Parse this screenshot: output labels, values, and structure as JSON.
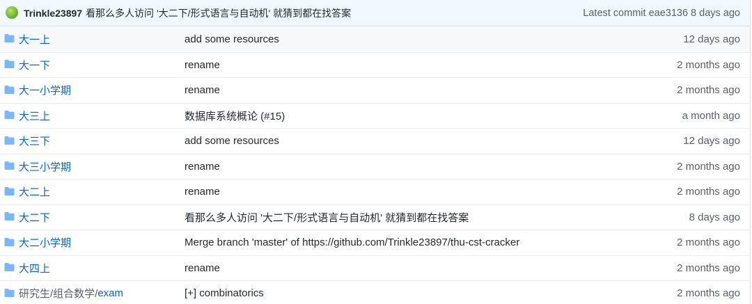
{
  "commit_bar": {
    "author": "Trinkle23897",
    "message": "看那么多人访问 '大二下/形式语言与自动机' 就猜到都在找答案",
    "latest_commit_label": "Latest commit",
    "sha": "eae3136",
    "age": "8 days ago"
  },
  "rows": [
    {
      "name": "大一上",
      "message": "add some resources",
      "age": "12 days ago"
    },
    {
      "name": "大一下",
      "message": "rename",
      "age": "2 months ago"
    },
    {
      "name": "大一小学期",
      "message": "rename",
      "age": "2 months ago"
    },
    {
      "name": "大三上",
      "message": "数据库系统概论 (#15)",
      "age": "a month ago"
    },
    {
      "name": "大三下",
      "message": "add some resources",
      "age": "12 days ago"
    },
    {
      "name": "大三小学期",
      "message": "rename",
      "age": "2 months ago"
    },
    {
      "name": "大二上",
      "message": "rename",
      "age": "2 months ago"
    },
    {
      "name": "大二下",
      "message": "看那么多人访问 '大二下/形式语言与自动机' 就猜到都在找答案",
      "age": "8 days ago"
    },
    {
      "name": "大二小学期",
      "message": "Merge branch 'master' of https://github.com/Trinkle23897/thu-cst-cracker",
      "age": "2 months ago"
    },
    {
      "name": "大四上",
      "message": "rename",
      "age": "2 months ago"
    },
    {
      "name_prefix": "研究生/组合数学/",
      "name_link": "exam",
      "message": "[+] combinatorics",
      "age": "2 months ago"
    }
  ],
  "icons": {
    "folder": "folder-icon",
    "avatar": "avatar"
  },
  "colors": {
    "link": "#0366d6",
    "folder": "#79b8ff",
    "commit_bar_bg": "#f1f8ff"
  }
}
